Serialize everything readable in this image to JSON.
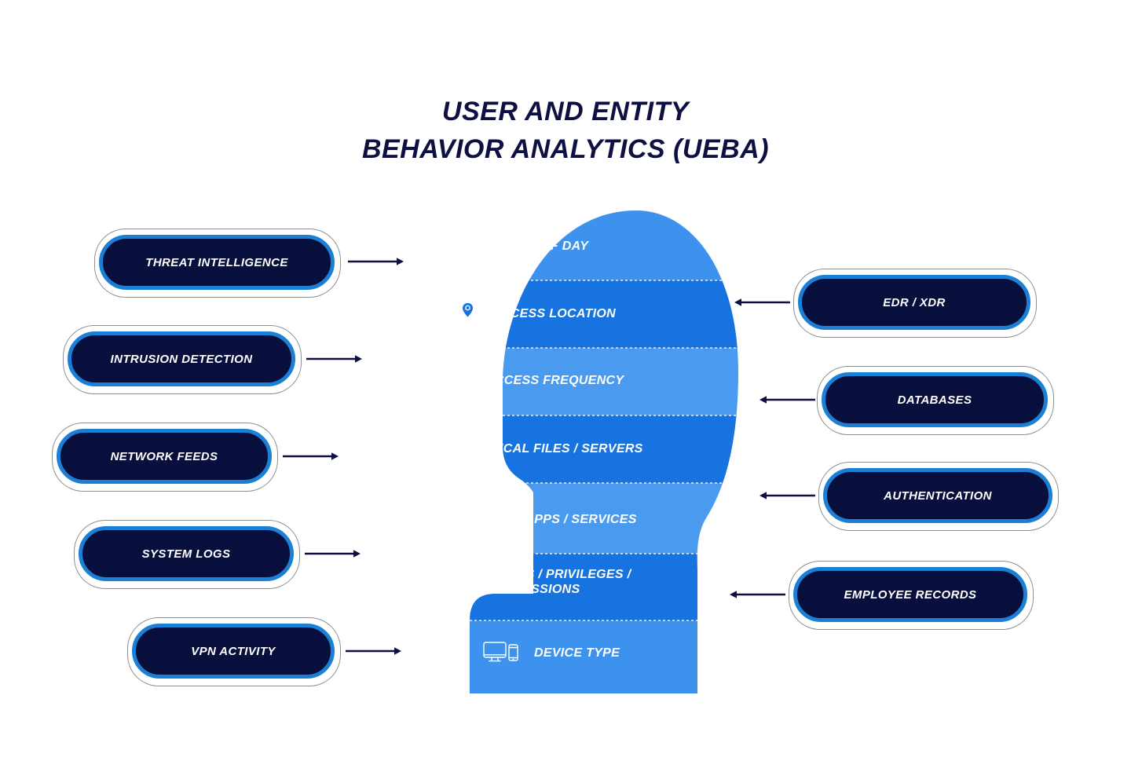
{
  "title": {
    "line1": "USER AND ENTITY",
    "line2": "BEHAVIOR ANALYTICS (UEBA)"
  },
  "colors": {
    "pill_fill": "#080f3d",
    "pill_border": "#1b7fd6",
    "pill_outline": "#8d8f92",
    "title_color": "#0d1040",
    "arrow_color": "#0d1040",
    "band_light": "#4a9bf0",
    "band_mid": "#2f86ea",
    "band_dark": "#1773df",
    "band_text": "#ffffff",
    "background": "#ffffff"
  },
  "left_sources": [
    {
      "label": "THREAT INTELLIGENCE"
    },
    {
      "label": "INTRUSION DETECTION"
    },
    {
      "label": "NETWORK FEEDS"
    },
    {
      "label": "SYSTEM LOGS"
    },
    {
      "label": "VPN ACTIVITY"
    }
  ],
  "right_sources": [
    {
      "label": "EDR / XDR"
    },
    {
      "label": "DATABASES"
    },
    {
      "label": "AUTHENTICATION"
    },
    {
      "label": "EMPLOYEE RECORDS"
    }
  ],
  "head_bands": [
    {
      "label": "TIME OF DAY",
      "icon": "stopwatch-icon"
    },
    {
      "label": "ACCESS LOCATION",
      "icon": "map-pin-icon"
    },
    {
      "label": "ACCESS FREQUENCY",
      "icon": "person-clock-icon"
    },
    {
      "label": "TYPICAL FILES / SERVERS",
      "icon": "server-stack-icon"
    },
    {
      "label": "TYPICAL APPS / SERVICES",
      "icon": "desktop-monitor-icon"
    },
    {
      "label": "ROLES / PRIVILEGES /\nPERMISSIONS",
      "icon": "people-group-icon"
    },
    {
      "label": "DEVICE TYPE",
      "icon": "desktop-mobile-icon"
    }
  ]
}
